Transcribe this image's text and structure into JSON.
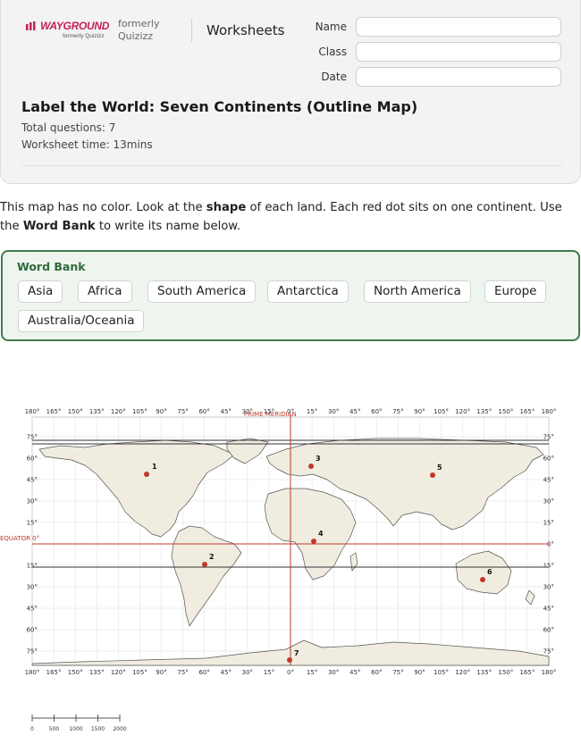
{
  "brand": {
    "logo_text": "WAYGROUND",
    "logo_sub": "formerly Quizizz",
    "formerly_line1": "formerly",
    "formerly_line2": "Quizizz"
  },
  "header": {
    "section": "Worksheets",
    "fields": [
      {
        "label": "Name",
        "value": ""
      },
      {
        "label": "Class",
        "value": ""
      },
      {
        "label": "Date",
        "value": ""
      }
    ],
    "title": "Label the World: Seven Continents (Outline Map)",
    "total_questions": "Total questions: 7",
    "worksheet_time": "Worksheet time: 13mins"
  },
  "instructions": {
    "part1": "This map has no color. Look at the ",
    "bold1": "shape",
    "part2": " of each land. Each red dot sits on one continent. Use the ",
    "bold2": "Word Bank",
    "part3": " to write its name below."
  },
  "word_bank": {
    "title": "Word Bank",
    "words": [
      "Asia",
      "Africa",
      "South America",
      "Antarctica",
      "North America",
      "Europe",
      "Australia/Oceania"
    ]
  },
  "map": {
    "top_labels": [
      "180°",
      "165°",
      "150°",
      "135°",
      "120°",
      "105°",
      "90°",
      "75°",
      "60°",
      "45°",
      "30°",
      "15°",
      "0°",
      "15°",
      "30°",
      "45°",
      "60°",
      "75°",
      "90°",
      "105°",
      "120°",
      "135°",
      "150°",
      "165°",
      "180°"
    ],
    "lat_labels": [
      "75°",
      "60°",
      "45°",
      "30°",
      "15°",
      "0°",
      "15°",
      "30°",
      "45°",
      "60°",
      "75°"
    ],
    "prime_meridian_label": "PRIME MERIDIAN",
    "equator_label": "EQUATOR 0°",
    "markers": [
      "1",
      "2",
      "3",
      "4",
      "5",
      "6",
      "7"
    ],
    "scale_labels": [
      "0",
      "500",
      "1000",
      "1500",
      "2000"
    ],
    "colors": {
      "land": "#f0ece0",
      "marker": "#c0392b",
      "reference_line": "#c0392b",
      "grid": "#dcdcdc"
    }
  }
}
